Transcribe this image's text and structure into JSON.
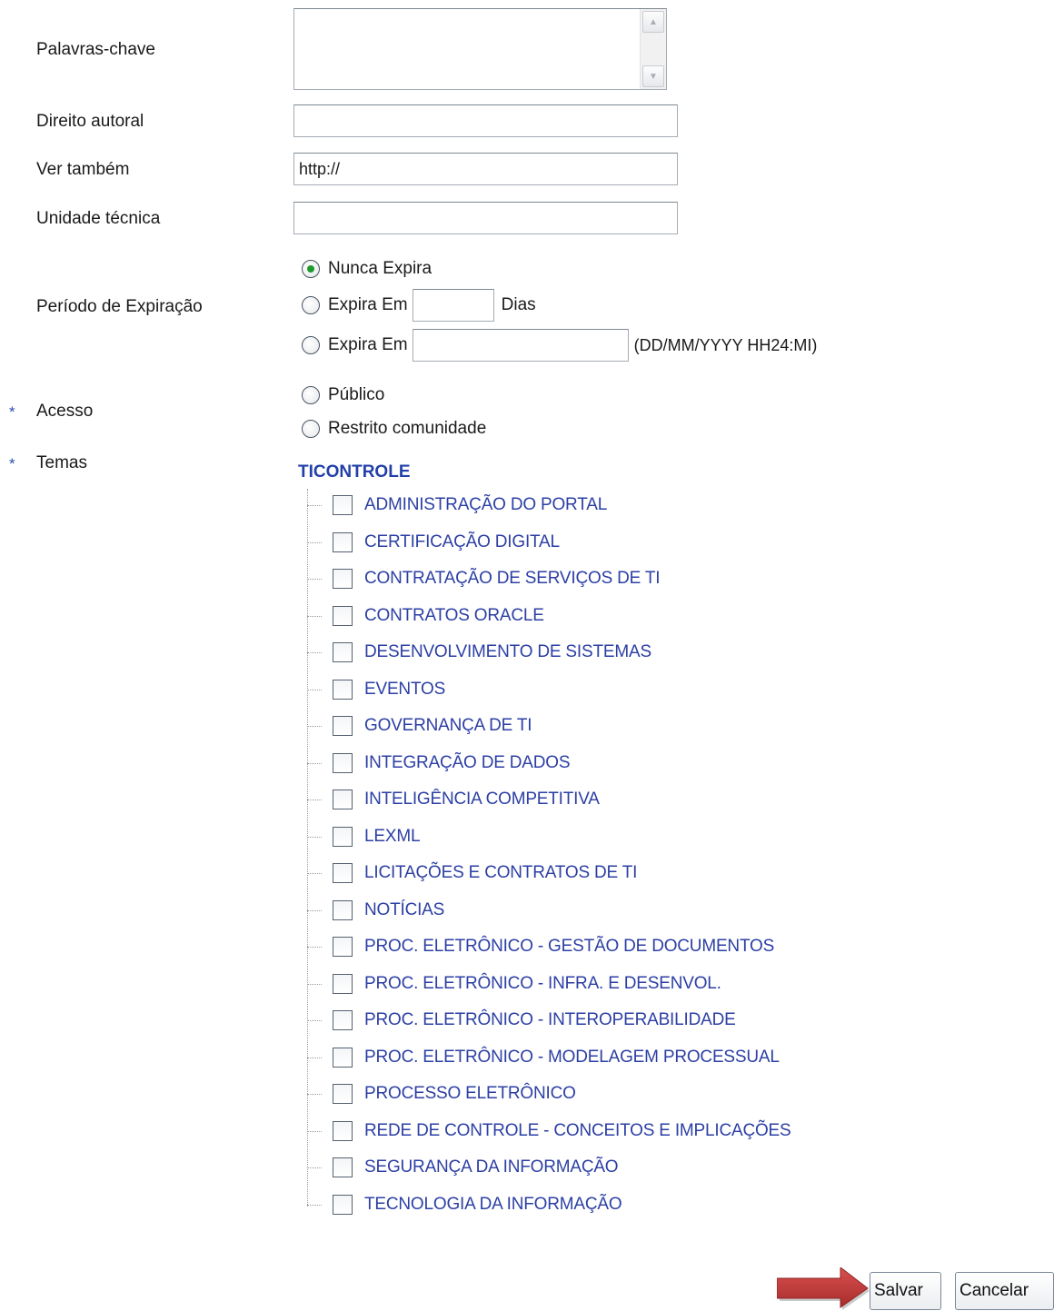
{
  "fields": {
    "keywords_label": "Palavras-chave",
    "keywords_value": "",
    "copyright_label": "Direito autoral",
    "copyright_value": "",
    "see_also_label": "Ver também",
    "see_also_value": "http://",
    "technical_unit_label": "Unidade técnica",
    "technical_unit_value": ""
  },
  "expiration": {
    "label": "Período de Expiração",
    "options": {
      "never": "Nunca Expira",
      "in_days": "Expira Em",
      "days_unit": "Dias",
      "on_date": "Expira Em",
      "date_format": "(DD/MM/YYYY HH24:MI)"
    },
    "selected": "never",
    "days_value": "",
    "date_value": ""
  },
  "access": {
    "required_mark": "*",
    "label": "Acesso",
    "options": {
      "public": "Público",
      "restricted": "Restrito comunidade"
    },
    "selected": ""
  },
  "themes": {
    "required_mark": "*",
    "label": "Temas",
    "group": "TICONTROLE",
    "items": [
      "ADMINISTRAÇÃO DO PORTAL",
      "CERTIFICAÇÃO DIGITAL",
      "CONTRATAÇÃO DE SERVIÇOS DE TI",
      "CONTRATOS ORACLE",
      "DESENVOLVIMENTO DE SISTEMAS",
      "EVENTOS",
      "GOVERNANÇA DE TI",
      "INTEGRAÇÃO DE DADOS",
      "INTELIGÊNCIA COMPETITIVA",
      "LEXML",
      "LICITAÇÕES E CONTRATOS DE TI",
      "NOTÍCIAS",
      "PROC. ELETRÔNICO - GESTÃO DE DOCUMENTOS",
      "PROC. ELETRÔNICO - INFRA. E DESENVOL.",
      "PROC. ELETRÔNICO - INTEROPERABILIDADE",
      "PROC. ELETRÔNICO - MODELAGEM PROCESSUAL",
      "PROCESSO ELETRÔNICO",
      "REDE DE CONTROLE - CONCEITOS E IMPLICAÇÕES",
      "SEGURANÇA DA INFORMAÇÃO",
      "TECNOLOGIA DA INFORMAÇÃO"
    ]
  },
  "actions": {
    "save": "Salvar",
    "cancel": "Cancelar"
  },
  "colors": {
    "link_blue": "#2c3fa4",
    "arrow_red": "#c0393a",
    "radio_green": "#1e9b2c"
  }
}
